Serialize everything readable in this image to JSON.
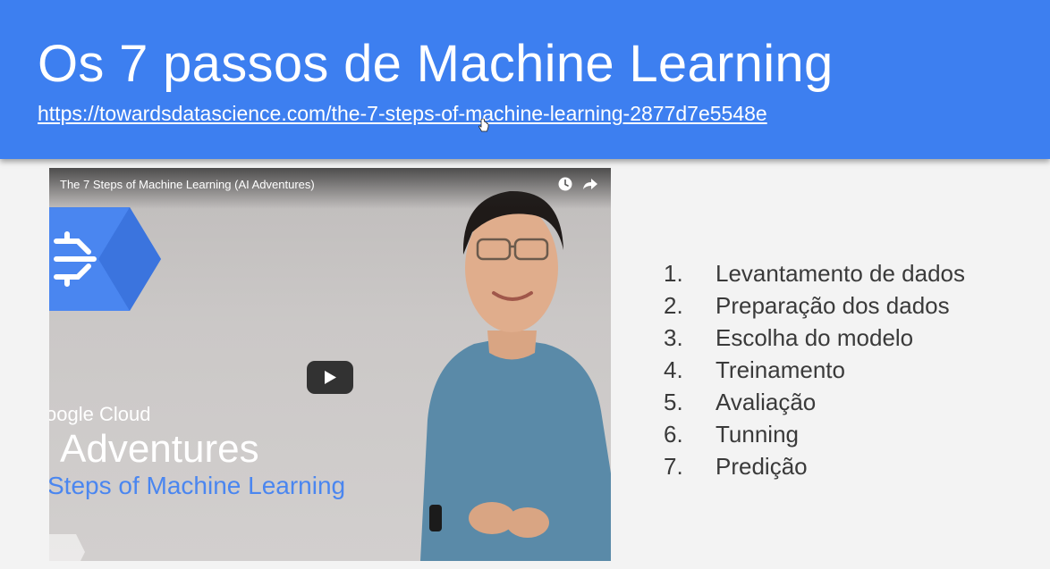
{
  "slide": {
    "title": "Os 7 passos de Machine Learning",
    "link": "https://towardsdatascience.com/the-7-steps-of-machine-learning-2877d7e5548e"
  },
  "video": {
    "title": "The 7 Steps of Machine Learning (AI Adventures)",
    "brand": "oogle Cloud",
    "series": "I Adventures",
    "subtitle": "Steps of  Machine Learning",
    "icons": [
      "watch-later-icon",
      "share-icon",
      "play-icon"
    ]
  },
  "steps": [
    {
      "num": "1.",
      "label": "Levantamento de dados"
    },
    {
      "num": "2.",
      "label": "Preparação dos dados"
    },
    {
      "num": "3.",
      "label": "Escolha do modelo"
    },
    {
      "num": "4.",
      "label": "Treinamento"
    },
    {
      "num": "5.",
      "label": "Avaliação"
    },
    {
      "num": "6.",
      "label": "Tunning"
    },
    {
      "num": "7.",
      "label": "Predição"
    }
  ],
  "colors": {
    "header": "#3d7ff0",
    "background": "#f3f3f3",
    "text": "#3a3a3a",
    "accent_blue": "#4a86f0"
  }
}
